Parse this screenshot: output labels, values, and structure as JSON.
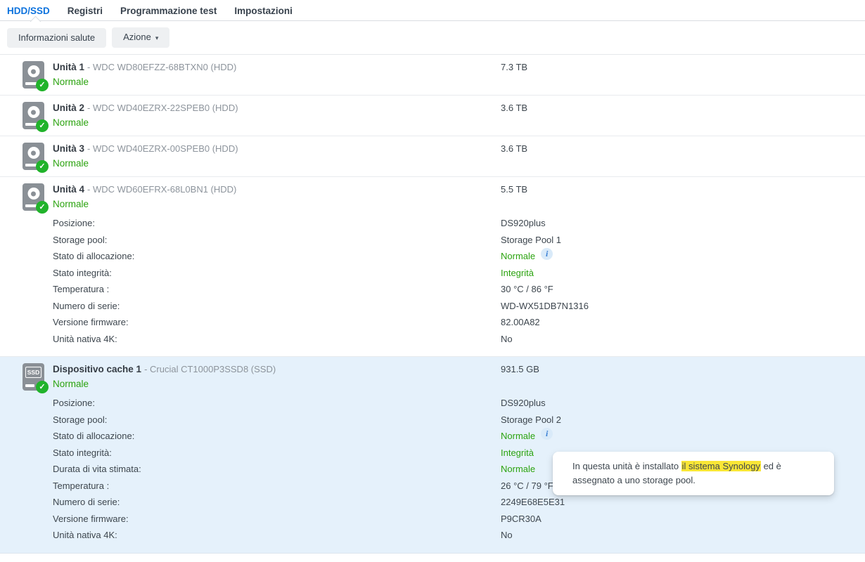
{
  "colors": {
    "accent_blue": "#0c72dd",
    "status_green": "#2ba30f",
    "selected_row_bg": "#e5f1fb",
    "tooltip_highlight_yellow": "#f9e636"
  },
  "icons": {
    "check": "✓",
    "caret_down": "▾",
    "info": "i",
    "ssd_label": "SSD"
  },
  "tabs": [
    {
      "label": "HDD/SSD",
      "active": true
    },
    {
      "label": "Registri",
      "active": false
    },
    {
      "label": "Programmazione test",
      "active": false
    },
    {
      "label": "Impostazioni",
      "active": false
    }
  ],
  "toolbar": {
    "health_label": "Informazioni salute",
    "action_label": "Azione"
  },
  "drives": [
    {
      "name": "Unità 1",
      "model": "- WDC WD80EFZZ-68BTXN0 (HDD)",
      "status": "Normale",
      "capacity": "7.3 TB"
    },
    {
      "name": "Unità 2",
      "model": "- WDC WD40EZRX-22SPEB0 (HDD)",
      "status": "Normale",
      "capacity": "3.6 TB"
    },
    {
      "name": "Unità 3",
      "model": "- WDC WD40EZRX-00SPEB0 (HDD)",
      "status": "Normale",
      "capacity": "3.6 TB"
    },
    {
      "name": "Unità 4",
      "model": "- WDC WD60EFRX-68L0BN1 (HDD)",
      "status": "Normale",
      "capacity": "5.5 TB",
      "details": [
        {
          "label": "Posizione:",
          "value": "DS920plus"
        },
        {
          "label": "Storage pool:",
          "value": "Storage Pool 1"
        },
        {
          "label": "Stato di allocazione:",
          "value": "Normale"
        },
        {
          "label": "Stato integrità:",
          "value": "Integrità"
        },
        {
          "label": "Temperatura :",
          "value": "30 °C / 86 °F"
        },
        {
          "label": "Numero di serie:",
          "value": "WD-WX51DB7N1316"
        },
        {
          "label": "Versione firmware:",
          "value": "82.00A82"
        },
        {
          "label": "Unità nativa 4K:",
          "value": "No"
        }
      ]
    },
    {
      "name": "Dispositivo cache 1",
      "model": "- Crucial CT1000P3SSD8 (SSD)",
      "status": "Normale",
      "capacity": "931.5 GB",
      "details": [
        {
          "label": "Posizione:",
          "value": "DS920plus"
        },
        {
          "label": "Storage pool:",
          "value": "Storage Pool 2"
        },
        {
          "label": "Stato di allocazione:",
          "value": "Normale"
        },
        {
          "label": "Stato integrità:",
          "value": "Integrità"
        },
        {
          "label": "Durata di vita stimata:",
          "value": "Normale"
        },
        {
          "label": "Temperatura :",
          "value": "26 °C / 79 °F"
        },
        {
          "label": "Numero di serie:",
          "value": "2249E68E5E31"
        },
        {
          "label": "Versione firmware:",
          "value": "P9CR30A"
        },
        {
          "label": "Unità nativa 4K:",
          "value": "No"
        }
      ]
    }
  ],
  "tooltip": {
    "before": "In questa unità è installato ",
    "highlight": "il sistema Synology",
    "after": " ed è",
    "line2": "assegnato a uno storage pool."
  }
}
